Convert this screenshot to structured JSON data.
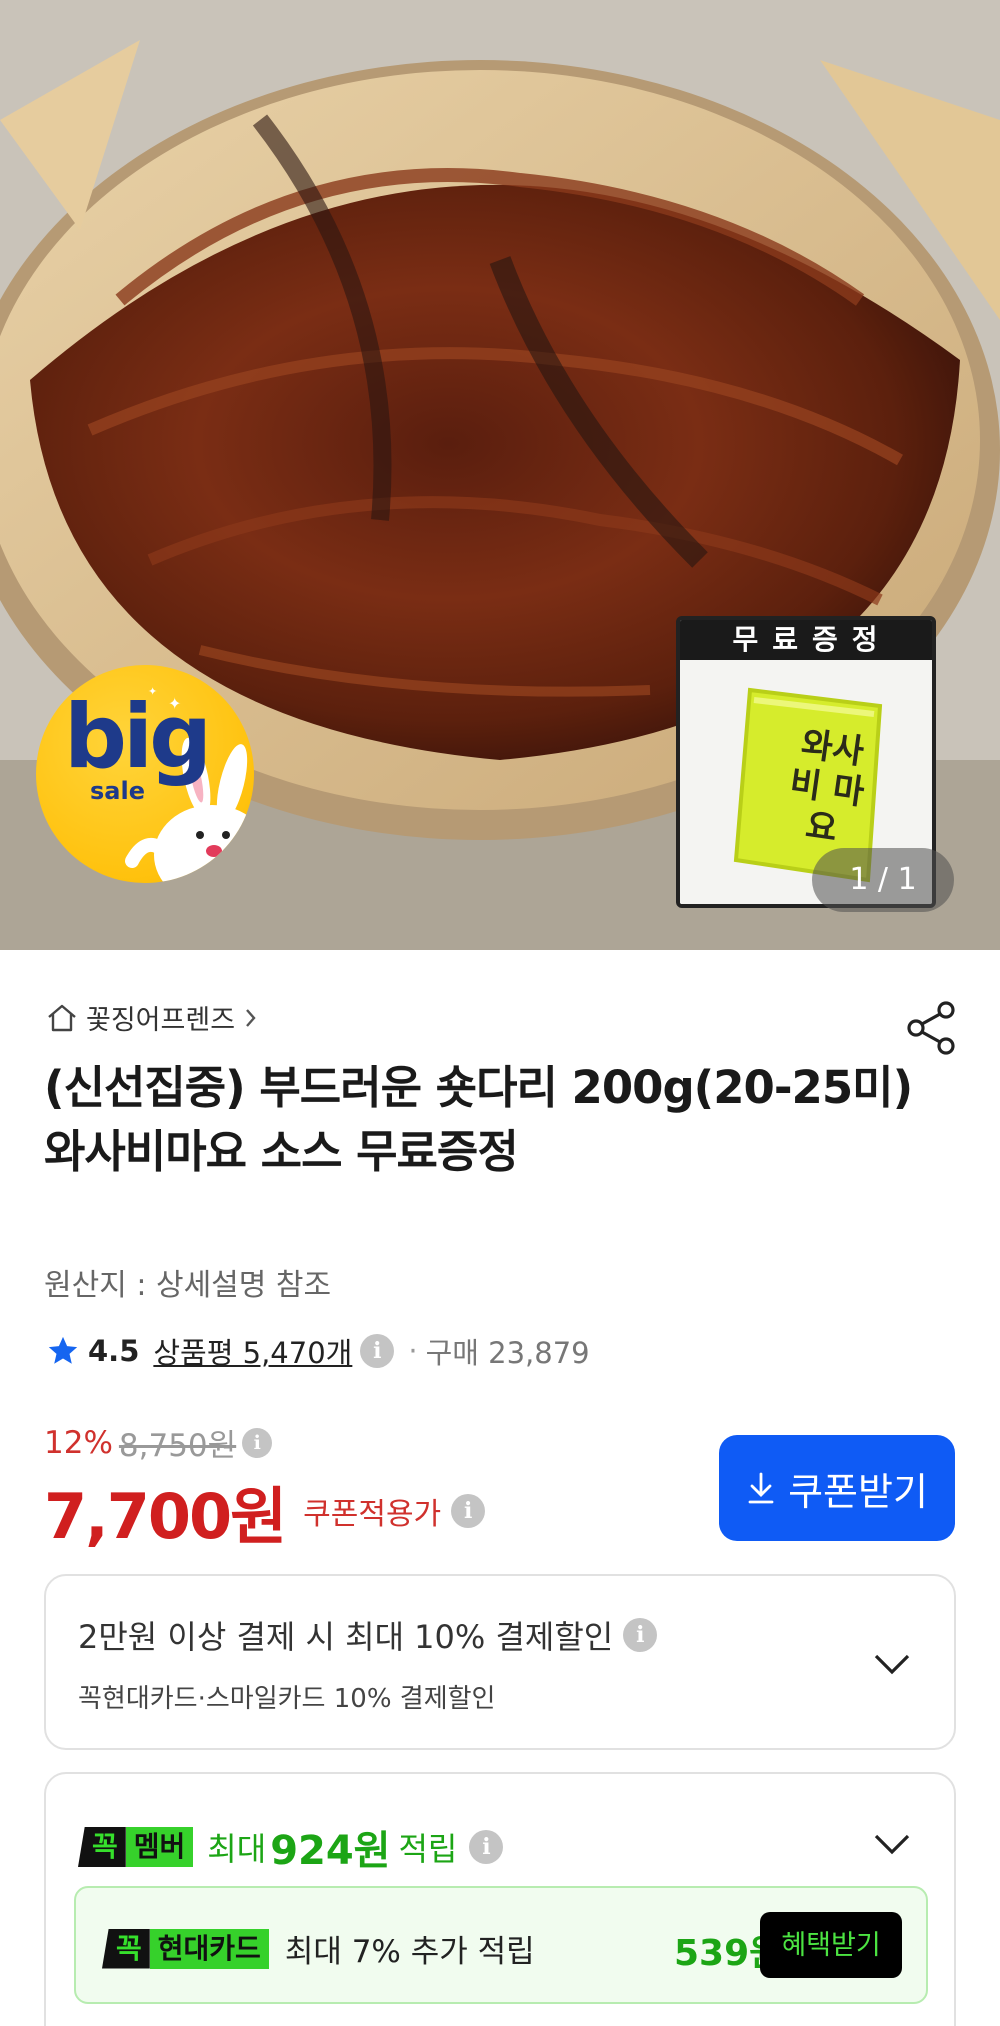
{
  "hero": {
    "badge": {
      "big": "big",
      "sale": "sale"
    },
    "gift": {
      "title": "무료증정",
      "pack_text": "와사비 마요"
    },
    "pager": "1 / 1"
  },
  "product": {
    "store": "꽃징어프렌즈",
    "title": "(신선집중) 부드러운 숏다리 200g(20-25미) 와사비마요 소스 무료증정",
    "origin": "원산지 : 상세설명 참조",
    "rating": "4.5",
    "review_label": "상품평 5,470개",
    "purchase": "구매 23,879"
  },
  "price": {
    "discount_rate": "12%",
    "original": "8,750원",
    "final": "7,700원",
    "coupon_label": "쿠폰적용가",
    "coupon_button": "쿠폰받기"
  },
  "payment": {
    "main": "2만원 이상 결제 시 최대  10% 결제할인",
    "sub": "꼭현대카드·스마일카드 10% 결제할인"
  },
  "membership": {
    "tag_k": "꼭",
    "tag_text": "멤버",
    "prefix": "최대",
    "amount": "924원",
    "suffix": "적립",
    "card": {
      "tag_k": "꼭",
      "tag_text": "현대카드",
      "text": "최대 7% 추가 적립",
      "amount": "539원",
      "button": "혜택받기"
    }
  },
  "colors": {
    "price_red": "#d01f1f",
    "coupon_blue": "#0f5bf5",
    "member_green": "#36d12b"
  },
  "icons": [
    "home-icon",
    "chevron-right-icon",
    "share-icon",
    "star-icon",
    "info-icon",
    "download-icon",
    "chevron-down-icon"
  ]
}
